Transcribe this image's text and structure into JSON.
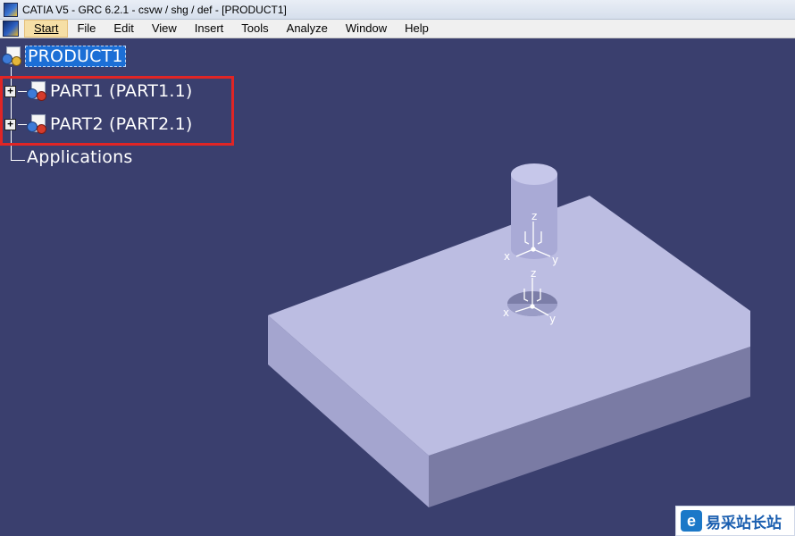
{
  "window": {
    "title": "CATIA V5 - GRC 6.2.1 - csvw / shg / def - [PRODUCT1]"
  },
  "menubar": {
    "items": [
      {
        "label": "Start",
        "active": true
      },
      {
        "label": "File"
      },
      {
        "label": "Edit"
      },
      {
        "label": "View"
      },
      {
        "label": "Insert"
      },
      {
        "label": "Tools"
      },
      {
        "label": "Analyze"
      },
      {
        "label": "Window"
      },
      {
        "label": "Help"
      }
    ]
  },
  "tree": {
    "root": {
      "label": "PRODUCT1",
      "icon": "product-icon"
    },
    "children": [
      {
        "label": "PART1 (PART1.1)",
        "icon": "part-icon",
        "expander": "+"
      },
      {
        "label": "PART2 (PART2.1)",
        "icon": "part-icon",
        "expander": "+"
      }
    ],
    "applications": {
      "label": "Applications"
    }
  },
  "axes": {
    "x": "x",
    "y": "y",
    "z": "z"
  },
  "watermark": {
    "logo": "e",
    "text": "易采站长站"
  },
  "colors": {
    "viewport_bg": "#3a3f6e",
    "highlight": "#e02525",
    "selection": "#1c6fd6",
    "part_top": "#bcbde2",
    "part_side_left": "#a4a5cf",
    "part_side_front": "#7a7ba4"
  }
}
